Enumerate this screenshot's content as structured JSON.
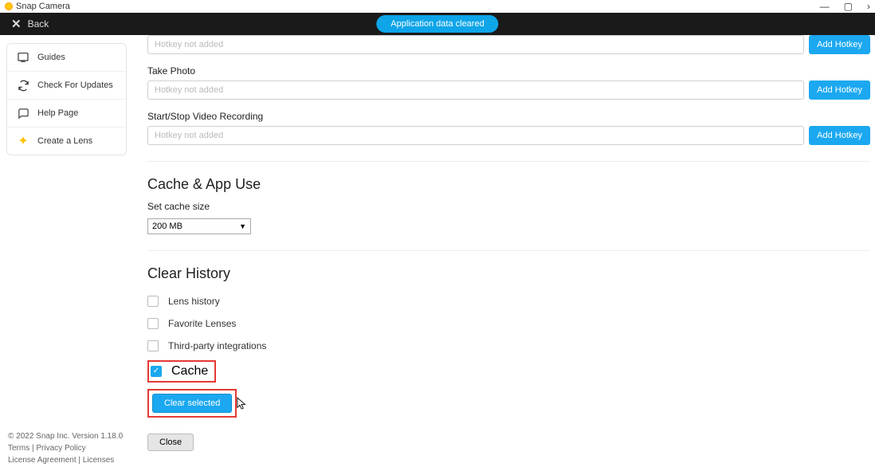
{
  "window": {
    "title": "Snap Camera"
  },
  "topbar": {
    "back_label": "Back",
    "toast": "Application data cleared"
  },
  "sidebar": {
    "items": [
      {
        "label": "Guides"
      },
      {
        "label": "Check For Updates"
      },
      {
        "label": "Help Page"
      },
      {
        "label": "Create a Lens"
      }
    ]
  },
  "footer": {
    "copyright": "© 2022 Snap Inc. Version 1.18.0",
    "links": [
      "Terms",
      "Privacy Policy",
      "License Agreement",
      "Licenses"
    ]
  },
  "hotkeys": {
    "row0": {
      "placeholder": "Hotkey not added",
      "btn": "Add Hotkey"
    },
    "row1": {
      "label": "Take Photo",
      "placeholder": "Hotkey not added",
      "btn": "Add Hotkey"
    },
    "row2": {
      "label": "Start/Stop Video Recording",
      "placeholder": "Hotkey not added",
      "btn": "Add Hotkey"
    }
  },
  "cache": {
    "title": "Cache & App Use",
    "set_label": "Set cache size",
    "selected": "200 MB"
  },
  "clear_history": {
    "title": "Clear History",
    "items": [
      {
        "label": "Lens history",
        "checked": false
      },
      {
        "label": "Favorite Lenses",
        "checked": false
      },
      {
        "label": "Third-party integrations",
        "checked": false
      },
      {
        "label": "Cache",
        "checked": true
      }
    ],
    "clear_btn": "Clear selected",
    "close_btn": "Close"
  }
}
